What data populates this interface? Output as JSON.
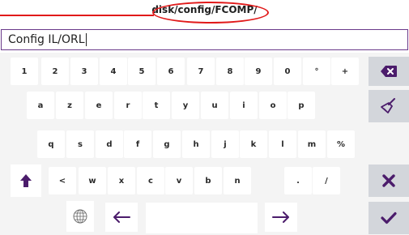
{
  "title": "disk/config/FCOMP/",
  "input": {
    "value": "Config IL/ORL"
  },
  "keyboard": {
    "row1": [
      "1",
      "2",
      "3",
      "4",
      "5",
      "6",
      "7",
      "8",
      "9",
      "0",
      "°",
      "+"
    ],
    "row2": [
      "a",
      "z",
      "e",
      "r",
      "t",
      "y",
      "u",
      "i",
      "o",
      "p"
    ],
    "row3": [
      "q",
      "s",
      "d",
      "f",
      "g",
      "h",
      "j",
      "k",
      "l",
      "m",
      "%"
    ],
    "row4": [
      "<",
      "w",
      "x",
      "c",
      "v",
      "b",
      "n",
      ".",
      "/"
    ]
  },
  "icons": {
    "backspace": "backspace-icon",
    "clear": "broom-clear-icon",
    "shift": "shift-up-arrow-icon",
    "close": "close-x-icon",
    "confirm": "checkmark-icon",
    "globe": "globe-icon",
    "left_arrow": "arrow-left-icon",
    "right_arrow": "arrow-right-icon"
  },
  "colors": {
    "accent": "#4b1c6b",
    "annotation": "#e11a1a",
    "side_key_bg": "#d3d6db",
    "keyboard_bg": "#f4f4f4"
  }
}
